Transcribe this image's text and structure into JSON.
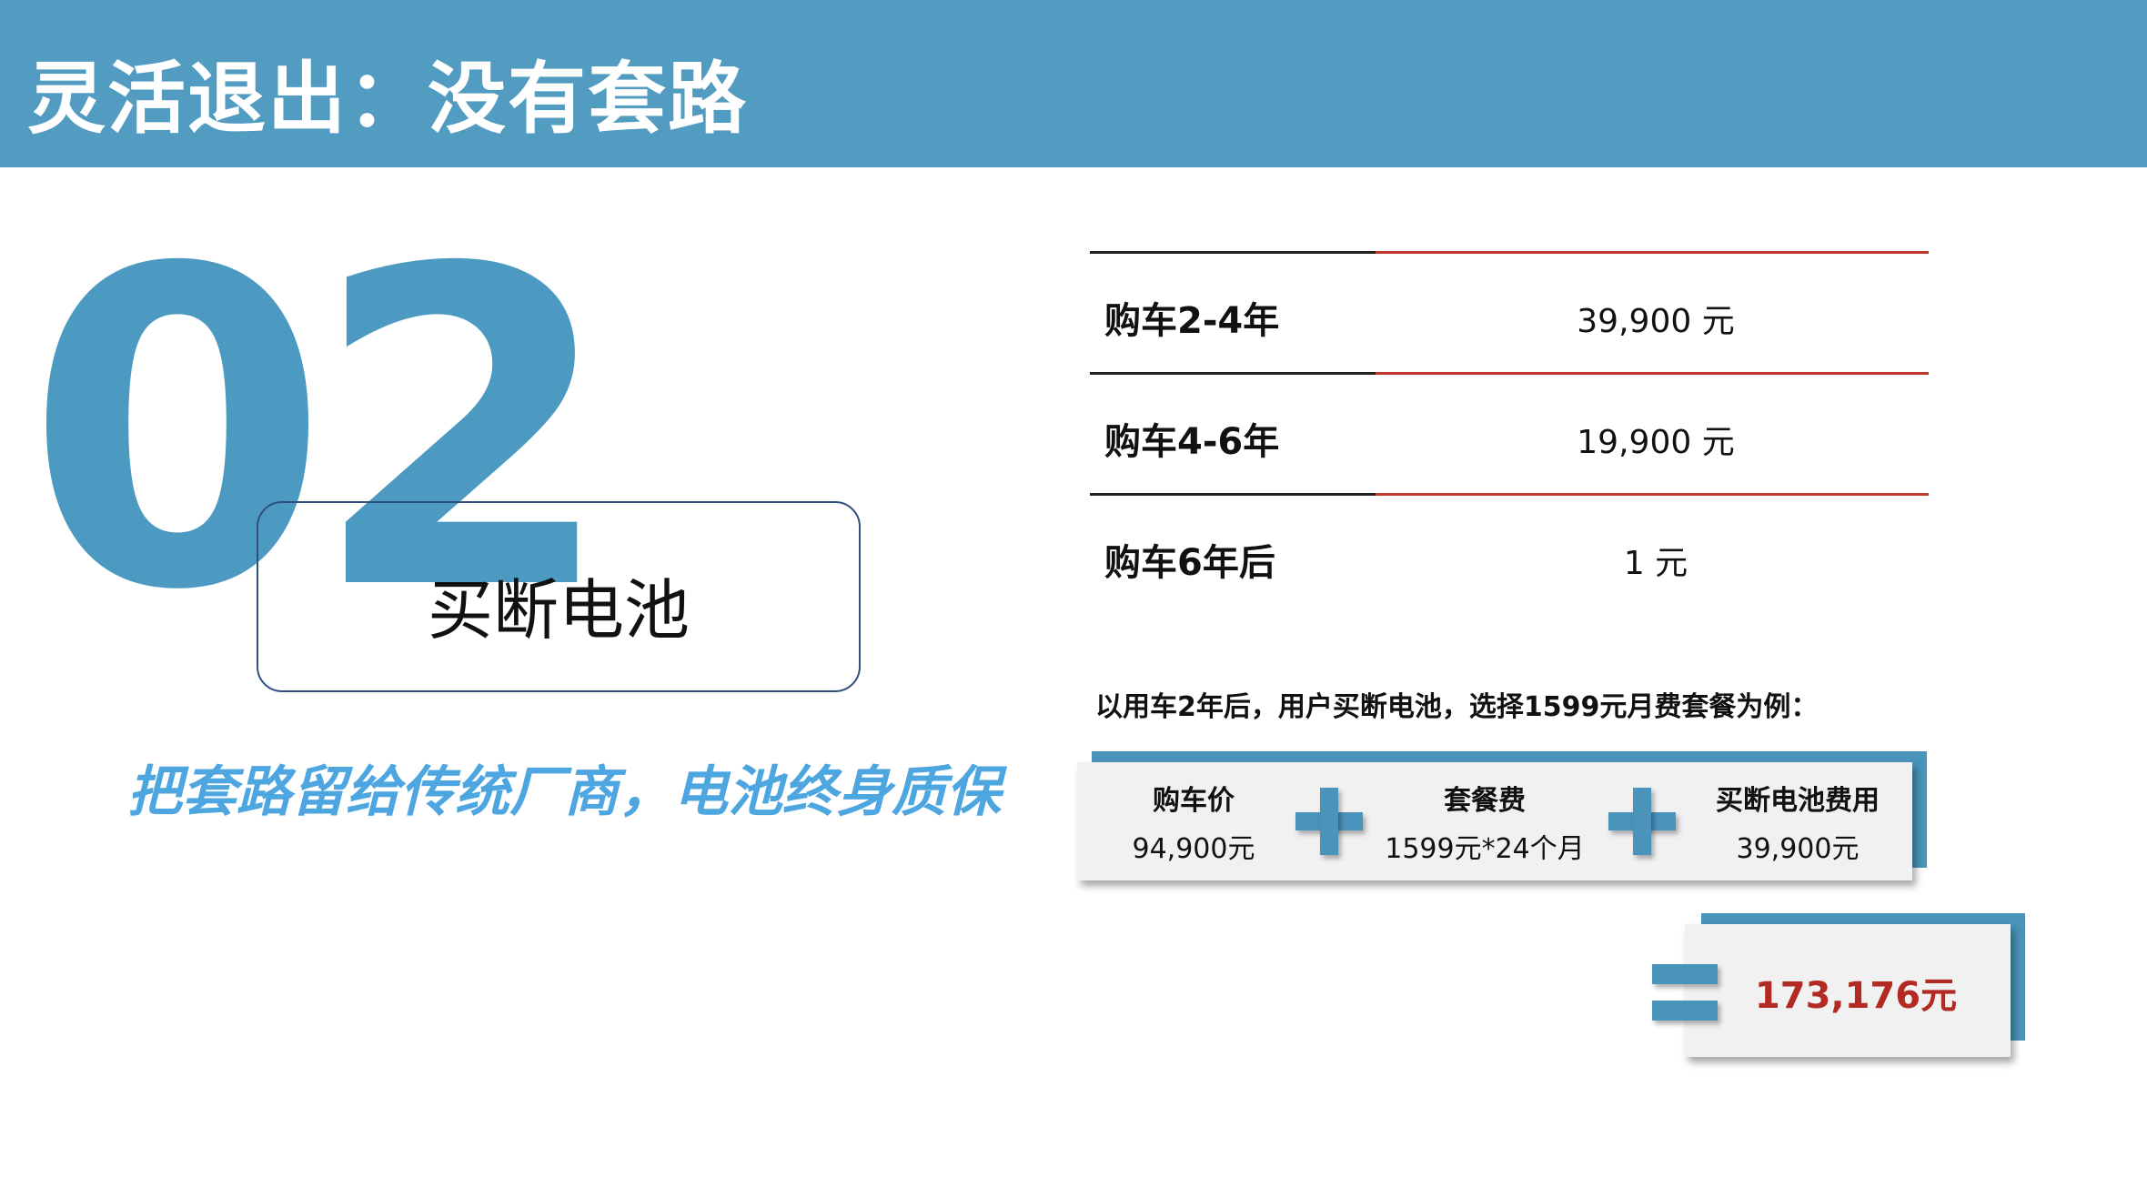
{
  "header": {
    "title": "灵活退出：没有套路",
    "bar_color": "#529cc1"
  },
  "section": {
    "number": "02",
    "topic": "买断电池",
    "slogan": "把套路留给传统厂商，电池终身质保"
  },
  "price_table": [
    {
      "label": "购车2-4年",
      "value": "39,900 元"
    },
    {
      "label": "购车4-6年",
      "value": "19,900 元"
    },
    {
      "label": "购车6年后",
      "value": "1 元"
    }
  ],
  "example": {
    "note": "以用车2年后，用户买断电池，选择1599元月费套餐为例：",
    "items": [
      {
        "title": "购车价",
        "value": "94,900元"
      },
      {
        "title": "套餐费",
        "value": "1599元*24个月"
      },
      {
        "title": "买断电池费用",
        "value": "39,900元"
      }
    ],
    "operator_icons": [
      "plus-icon",
      "plus-icon",
      "equals-icon"
    ],
    "total": "173,176元",
    "total_color": "#b22a22"
  }
}
